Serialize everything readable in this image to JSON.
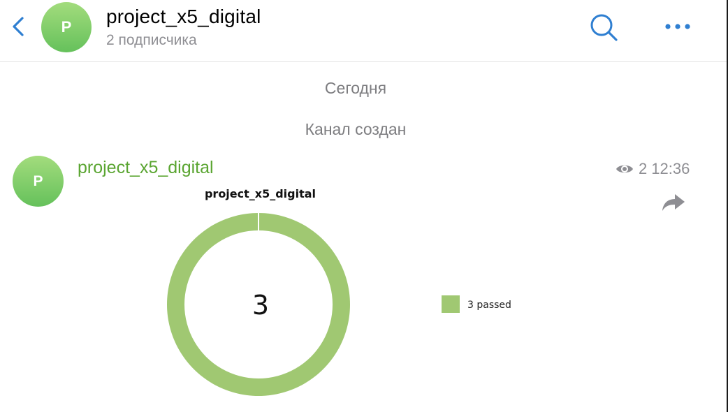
{
  "header": {
    "avatar_letter": "P",
    "title": "project_x5_digital",
    "subtitle": "2 подписчика"
  },
  "chat": {
    "date_separator": "Сегодня",
    "service_message": "Канал создан"
  },
  "message": {
    "avatar_letter": "P",
    "author": "project_x5_digital",
    "views": "2",
    "time": "12:36"
  },
  "colors": {
    "accent_blue": "#2f7fd1",
    "author_green": "#5aa531",
    "avatar_gradient_top": "#a3dc7d",
    "avatar_gradient_bottom": "#65c15b",
    "secondary_text": "#8e8e93",
    "donut_green": "#a0c872"
  },
  "chart_data": {
    "type": "pie",
    "title": "project_x5_digital",
    "center_label": "3",
    "slices": [
      {
        "label": "passed",
        "value": 3,
        "color": "#a0c872"
      }
    ],
    "legend": [
      {
        "text": "3 passed",
        "color": "#a0c872"
      }
    ],
    "legend_position": "right"
  }
}
